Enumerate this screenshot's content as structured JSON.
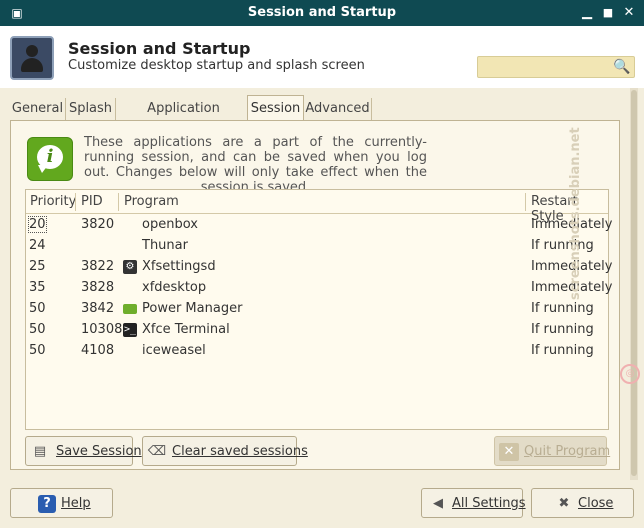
{
  "window": {
    "title": "Session and Startup",
    "minimize_icon": "minimize-icon",
    "maximize_icon": "maximize-icon",
    "close_icon": "close-icon"
  },
  "header": {
    "title": "Session and Startup",
    "subtitle": "Customize desktop startup and splash screen",
    "search_value": "",
    "search_icon": "search-icon"
  },
  "tabs": [
    {
      "label": "General"
    },
    {
      "label": "Splash"
    },
    {
      "label": "Application Autostart"
    },
    {
      "label": "Session",
      "active": true
    },
    {
      "label": "Advanced"
    }
  ],
  "session": {
    "info": "These applications are a part of the currently-running session, and can be saved when you log out. Changes below will only take effect when the session is saved.",
    "columns": {
      "priority": "Priority",
      "pid": "PID",
      "program": "Program",
      "restart": "Restart Style"
    },
    "rows": [
      {
        "priority": "20",
        "pid": "3820",
        "program": "openbox",
        "restart": "Immediately",
        "icon": ""
      },
      {
        "priority": "24",
        "pid": "",
        "program": "Thunar",
        "restart": "If running",
        "icon": ""
      },
      {
        "priority": "25",
        "pid": "3822",
        "program": "Xfsettingsd",
        "restart": "Immediately",
        "icon": "settings-icon"
      },
      {
        "priority": "35",
        "pid": "3828",
        "program": "xfdesktop",
        "restart": "Immediately",
        "icon": ""
      },
      {
        "priority": "50",
        "pid": "3842",
        "program": "Power Manager",
        "restart": "If running",
        "icon": "battery-icon"
      },
      {
        "priority": "50",
        "pid": "10308",
        "program": "Xfce Terminal",
        "restart": "If running",
        "icon": "terminal-icon"
      },
      {
        "priority": "50",
        "pid": "4108",
        "program": "iceweasel",
        "restart": "If running",
        "icon": ""
      }
    ],
    "save_label": "Save Session",
    "clear_label": "Clear saved sessions",
    "quit_label": "Quit Program"
  },
  "footer": {
    "help_label": "Help",
    "all_settings_label": "All Settings",
    "close_label": "Close"
  },
  "watermark": "screenshots.debian.net",
  "colors": {
    "titlebar": "#0f4a52",
    "accent_info": "#62a81e",
    "help_icon": "#2a5db0"
  }
}
